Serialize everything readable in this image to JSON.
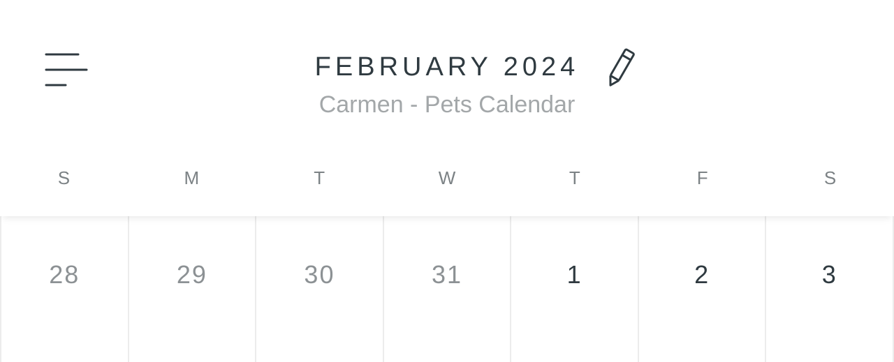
{
  "header": {
    "month_title": "FEBRUARY 2024",
    "subtitle": "Carmen - Pets Calendar",
    "menu_icon": "hamburger-menu-icon",
    "edit_icon": "pencil-icon"
  },
  "weekdays": [
    "S",
    "M",
    "T",
    "W",
    "T",
    "F",
    "S"
  ],
  "week": [
    {
      "day": "28",
      "in_month": false
    },
    {
      "day": "29",
      "in_month": false
    },
    {
      "day": "30",
      "in_month": false
    },
    {
      "day": "31",
      "in_month": false
    },
    {
      "day": "1",
      "in_month": true
    },
    {
      "day": "2",
      "in_month": true
    },
    {
      "day": "3",
      "in_month": true
    }
  ],
  "colors": {
    "title": "#2f3a40",
    "subtitle": "#a3a7a9",
    "weekday": "#7c8285",
    "other_month_day": "#8c9194",
    "current_month_day": "#2f3a40",
    "grid_line": "#ececec"
  }
}
